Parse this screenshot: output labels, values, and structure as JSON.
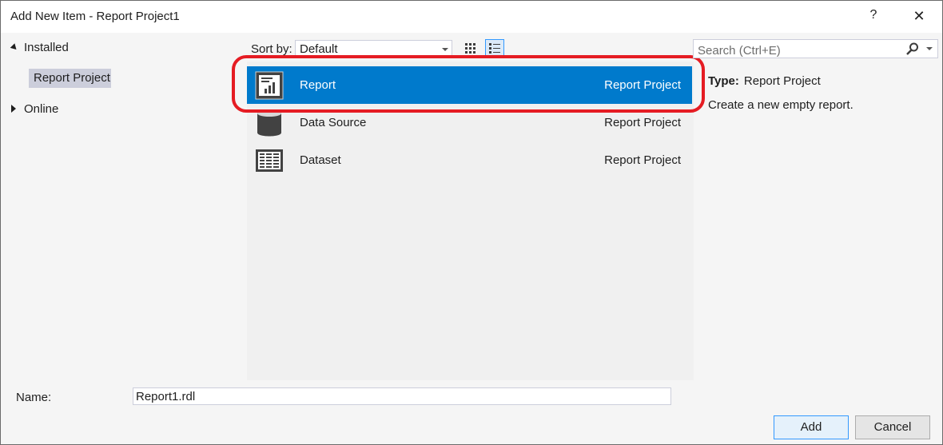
{
  "window": {
    "title": "Add New Item - Report Project1",
    "help_glyph": "?",
    "close_glyph": "✕"
  },
  "tree": {
    "installed_label": "Installed",
    "report_project_label": "Report Project",
    "online_label": "Online"
  },
  "toolbar": {
    "sort_by_label": "Sort by:",
    "sort_value": "Default"
  },
  "items": [
    {
      "name": "Report",
      "category": "Report Project",
      "icon": "report-icon"
    },
    {
      "name": "Data Source",
      "category": "Report Project",
      "icon": "data-source-icon"
    },
    {
      "name": "Dataset",
      "category": "Report Project",
      "icon": "dataset-icon"
    }
  ],
  "search": {
    "placeholder": "Search (Ctrl+E)"
  },
  "details": {
    "type_label": "Type:",
    "type_value": "Report Project",
    "description": "Create a new empty report."
  },
  "bottom": {
    "name_label": "Name:",
    "name_value": "Report1.rdl",
    "add_label": "Add",
    "cancel_label": "Cancel"
  },
  "colors": {
    "selection": "#007acc",
    "highlight_ring": "#e51c23",
    "tree_selection": "#cccedb"
  }
}
